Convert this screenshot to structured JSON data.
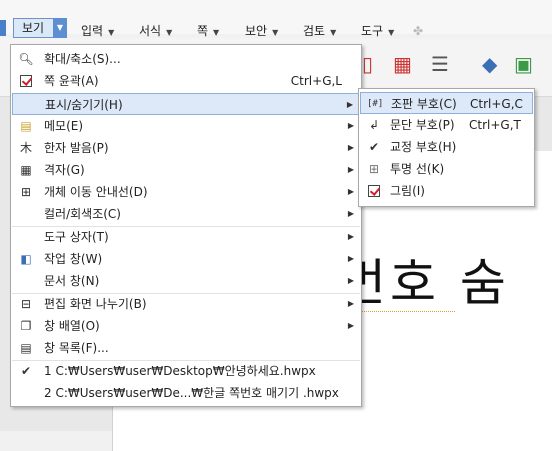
{
  "menubar": {
    "items": [
      {
        "label": "보기"
      },
      {
        "label": "입력"
      },
      {
        "label": "서식"
      },
      {
        "label": "쪽"
      },
      {
        "label": "보안"
      },
      {
        "label": "검토"
      },
      {
        "label": "도구"
      }
    ]
  },
  "document": {
    "visible_text": "번호 숨"
  },
  "view_menu": {
    "items": [
      {
        "icon": "zoom-icon",
        "label": "확대/축소(S)...",
        "shortcut": "",
        "submenu": false
      },
      {
        "icon": "checkbox-checked-icon",
        "label": "쪽 윤곽(A)",
        "shortcut": "Ctrl+G,L",
        "submenu": false
      },
      {
        "icon": "",
        "label": "표시/숨기기(H)",
        "shortcut": "",
        "submenu": true
      },
      {
        "icon": "memo-icon",
        "label": "메모(E)",
        "shortcut": "",
        "submenu": true
      },
      {
        "icon": "hanja-pronunciation-icon",
        "label": "한자 발음(P)",
        "shortcut": "",
        "submenu": true
      },
      {
        "icon": "grid-icon",
        "label": "격자(G)",
        "shortcut": "",
        "submenu": true
      },
      {
        "icon": "object-guide-icon",
        "label": "개체 이동 안내선(D)",
        "shortcut": "",
        "submenu": true
      },
      {
        "icon": "",
        "label": "컬러/회색조(C)",
        "shortcut": "",
        "submenu": true
      },
      {
        "icon": "",
        "label": "도구 상자(T)",
        "shortcut": "",
        "submenu": true
      },
      {
        "icon": "task-pane-icon",
        "label": "작업 창(W)",
        "shortcut": "",
        "submenu": true
      },
      {
        "icon": "",
        "label": "문서 창(N)",
        "shortcut": "",
        "submenu": true
      },
      {
        "icon": "split-screen-icon",
        "label": "편집 화면 나누기(B)",
        "shortcut": "",
        "submenu": true
      },
      {
        "icon": "arrange-windows-icon",
        "label": "창 배열(O)",
        "shortcut": "",
        "submenu": true
      },
      {
        "icon": "window-list-icon",
        "label": "창 목록(F)...",
        "shortcut": "",
        "submenu": false
      },
      {
        "icon": "check-icon",
        "label": "1 C:₩Users₩user₩Desktop₩안녕하세요.hwpx",
        "shortcut": "",
        "submenu": false
      },
      {
        "icon": "",
        "label": "2 C:₩Users₩user₩De...₩한글 쪽번호 매기기 .hwpx",
        "shortcut": "",
        "submenu": false
      }
    ]
  },
  "show_hide_submenu": {
    "items": [
      {
        "icon": "control-code-icon",
        "label": "조판 부호(C)",
        "shortcut": "Ctrl+G,C"
      },
      {
        "icon": "paragraph-mark-icon",
        "label": "문단 부호(P)",
        "shortcut": "Ctrl+G,T"
      },
      {
        "icon": "proofread-mark-icon",
        "label": "교정 부호(H)",
        "shortcut": ""
      },
      {
        "icon": "transparent-line-icon",
        "label": "투명 선(K)",
        "shortcut": ""
      },
      {
        "icon": "checkbox-checked-icon",
        "label": "그림(I)",
        "shortcut": ""
      }
    ]
  }
}
